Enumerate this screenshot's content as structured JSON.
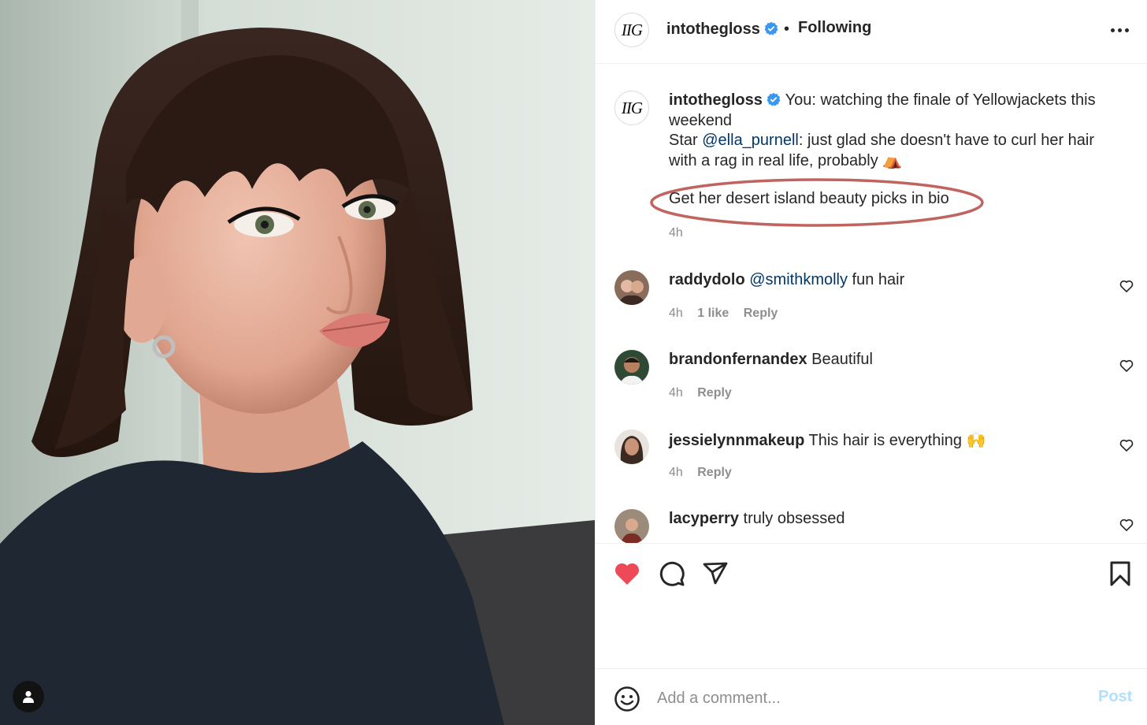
{
  "photo": {
    "alt_icon": "person-icon"
  },
  "header": {
    "avatar_text": "IIG",
    "username": "intothegloss",
    "separator": "•",
    "follow_status": "Following",
    "more_icon": "more-horizontal-icon"
  },
  "caption": {
    "avatar_text": "IIG",
    "username": "intothegloss",
    "line1": "You: watching the finale of Yellowjackets this weekend",
    "line2_prefix": "Star ",
    "mention": "@ella_purnell",
    "line2_suffix": ": just glad she doesn't have to curl her hair with a rag in real life, probably",
    "emoji": "⛺",
    "cta": "Get her desert island beauty picks in bio",
    "time": "4h",
    "highlight_color": "#c0645f"
  },
  "comments": [
    {
      "username": "raddydolo",
      "mention": "@smithkmolly",
      "text": " fun hair",
      "time": "4h",
      "likes": "1 like",
      "reply": "Reply"
    },
    {
      "username": "brandonfernandex",
      "mention": "",
      "text": " Beautiful",
      "time": "4h",
      "likes": "",
      "reply": "Reply"
    },
    {
      "username": "jessielynnmakeup",
      "mention": "",
      "text": " This hair is everything 🙌",
      "time": "4h",
      "likes": "",
      "reply": "Reply"
    },
    {
      "username": "lacyperry",
      "mention": "",
      "text": " truly obsessed",
      "time": "",
      "likes": "",
      "reply": ""
    }
  ],
  "actions": {
    "liked": true,
    "like_color": "#ed4956"
  },
  "composer": {
    "placeholder": "Add a comment...",
    "post_label": "Post"
  },
  "colors": {
    "link": "#00376b",
    "muted": "#8e8e8e",
    "verified": "#3897f0",
    "post_disabled": "#b2dffc"
  }
}
